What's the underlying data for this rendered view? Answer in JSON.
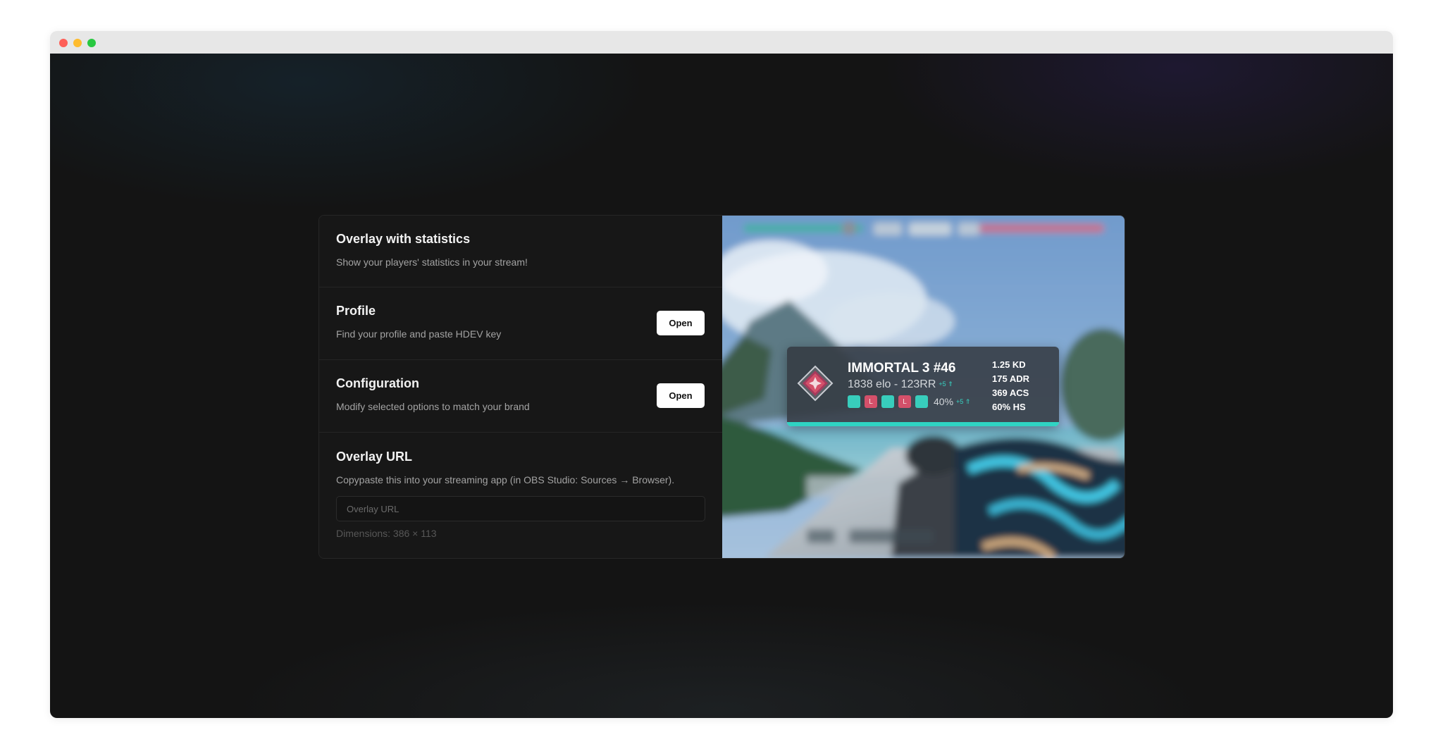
{
  "window": {
    "controls": [
      "close",
      "minimize",
      "zoom"
    ]
  },
  "sections": {
    "intro": {
      "title": "Overlay with statistics",
      "description": "Show your players' statistics in your stream!"
    },
    "profile": {
      "title": "Profile",
      "description": "Find your profile and paste HDEV key",
      "button_label": "Open"
    },
    "configuration": {
      "title": "Configuration",
      "description": "Modify selected options to match your brand",
      "button_label": "Open"
    },
    "overlay_url": {
      "title": "Overlay URL",
      "description": "Copypaste this into your streaming app (in OBS Studio: Sources → Browser).",
      "input_value": "",
      "input_placeholder": "Overlay URL",
      "dimensions_text": "Dimensions: 386 × 113"
    }
  },
  "preview": {
    "rank_icon": "immortal-rank-icon",
    "rank_title": "IMMORTAL 3 #46",
    "elo_text": "1838 elo - 123RR",
    "rr_delta": "+5 ⇑",
    "recent_games": [
      {
        "result": "W",
        "label": "W"
      },
      {
        "result": "L",
        "label": "L"
      },
      {
        "result": "W",
        "label": "W"
      },
      {
        "result": "L",
        "label": "L"
      },
      {
        "result": "W",
        "label": "W"
      }
    ],
    "winrate_text": "40%",
    "winrate_delta": "+5 ⇑",
    "stats": [
      "1.25 KD",
      "175 ADR",
      "369 ACS",
      "60% HS"
    ],
    "rank_progress": 1.0,
    "colors": {
      "accent": "#2fd3c3",
      "win": "#38cdbc",
      "loss": "#d4506a"
    }
  }
}
